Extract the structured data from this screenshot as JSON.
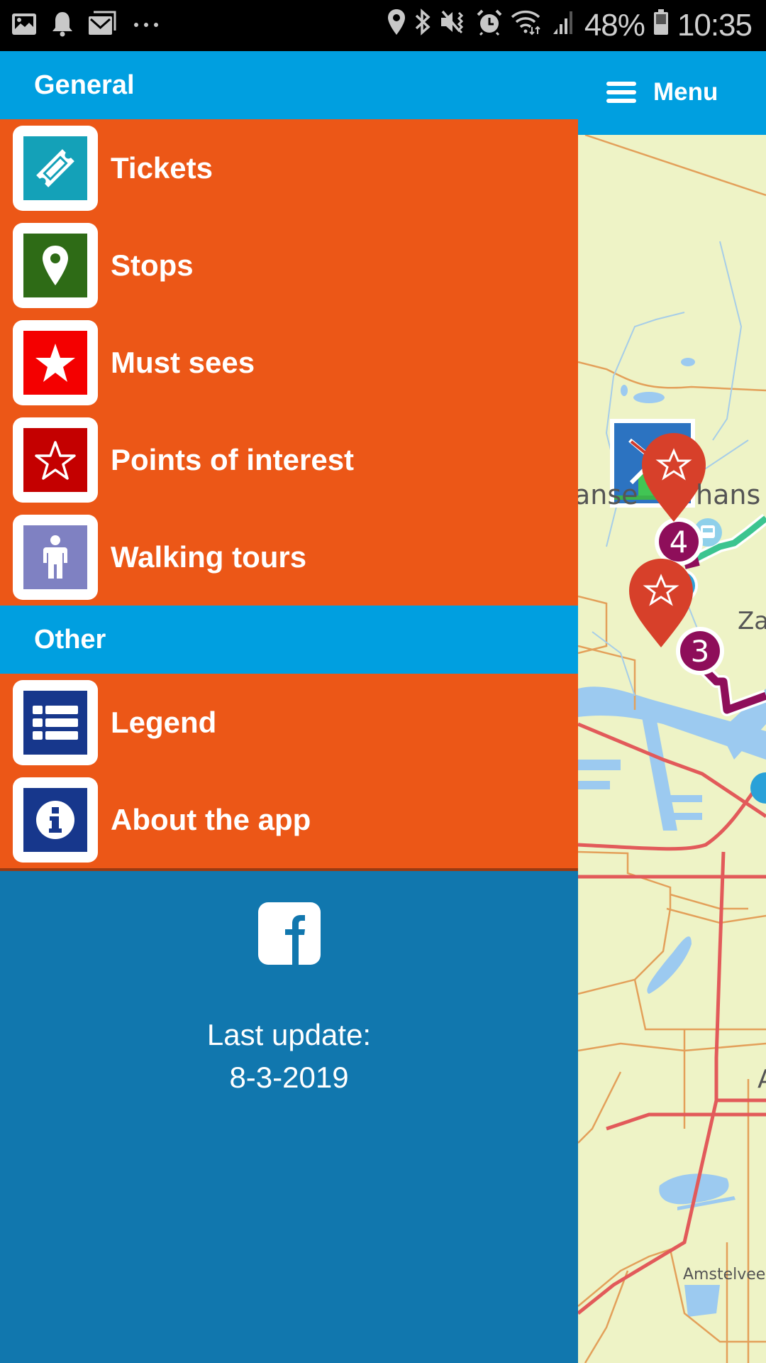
{
  "status_bar": {
    "left_icons": [
      "gallery-icon",
      "bell-icon",
      "mail-icon",
      "more-dots-icon"
    ],
    "right_icons": [
      "location-icon",
      "bluetooth-icon",
      "vibrate-mute-icon",
      "alarm-icon",
      "wifi-icon",
      "signal-icon"
    ],
    "battery_percent": "48%",
    "time": "10:35"
  },
  "app_bar": {
    "menu_label": "Menu",
    "menu_icon": "hamburger-icon",
    "color": "#009fe0"
  },
  "drawer": {
    "sections": [
      {
        "title": "General",
        "items": [
          {
            "label": "Tickets",
            "icon": "ticket-icon",
            "icon_bg": "#14a1b8"
          },
          {
            "label": "Stops",
            "icon": "map-pin-icon",
            "icon_bg": "#2e6b16"
          },
          {
            "label": "Must sees",
            "icon": "star-filled-icon",
            "icon_bg": "#f40000"
          },
          {
            "label": "Points of interest",
            "icon": "star-outline-icon",
            "icon_bg": "#c40000"
          },
          {
            "label": "Walking tours",
            "icon": "person-icon",
            "icon_bg": "#7f81c2"
          }
        ]
      },
      {
        "title": "Other",
        "items": [
          {
            "label": "Legend",
            "icon": "list-icon",
            "icon_bg": "#17378c"
          },
          {
            "label": "About the app",
            "icon": "info-icon",
            "icon_bg": "#17378c"
          }
        ]
      }
    ],
    "item_bg": "#ec5717",
    "header_bg": "#009fe0",
    "footer_bg": "#1177ae",
    "footer": {
      "social_icon": "facebook-icon",
      "last_update_label": "Last update:",
      "last_update_date": "8-3-2019"
    }
  },
  "map": {
    "labels": [
      "anse",
      "hans",
      "Za",
      "A",
      "Amstelveen"
    ],
    "markers": [
      {
        "type": "must-see-pin",
        "icon": "star-outline-icon"
      },
      {
        "type": "must-see-pin",
        "icon": "star-outline-icon"
      },
      {
        "type": "stop-number",
        "value": "4"
      },
      {
        "type": "stop-number",
        "value": "3"
      },
      {
        "type": "bus-stop",
        "icon": "bus-icon"
      },
      {
        "type": "bus-stop",
        "icon": "bus-icon"
      }
    ],
    "poi_icon": "windmill-icon"
  }
}
